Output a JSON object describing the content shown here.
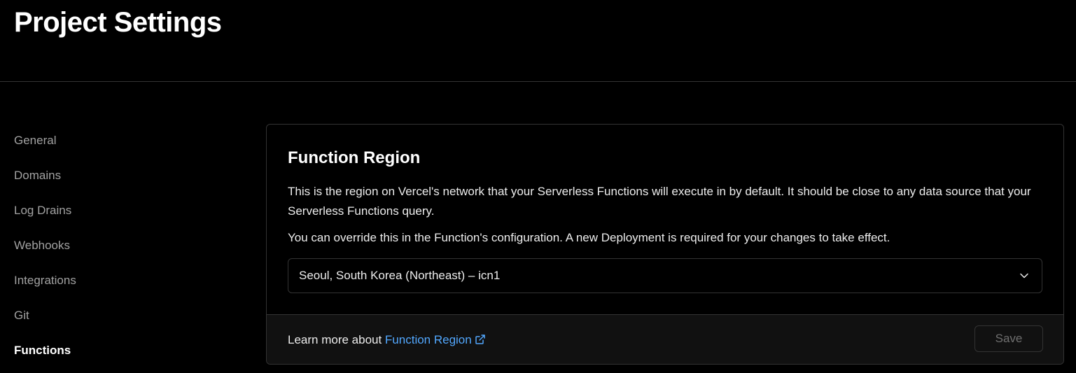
{
  "header": {
    "title": "Project Settings"
  },
  "sidebar": {
    "items": [
      {
        "label": "General",
        "active": false
      },
      {
        "label": "Domains",
        "active": false
      },
      {
        "label": "Log Drains",
        "active": false
      },
      {
        "label": "Webhooks",
        "active": false
      },
      {
        "label": "Integrations",
        "active": false
      },
      {
        "label": "Git",
        "active": false
      },
      {
        "label": "Functions",
        "active": true
      }
    ]
  },
  "function_region": {
    "title": "Function Region",
    "description": "This is the region on Vercel's network that your Serverless Functions will execute in by default. It should be close to any data source that your Serverless Functions query.",
    "override_note": "You can override this in the Function's configuration. A new Deployment is required for your changes to take effect.",
    "select": {
      "value": "Seoul, South Korea (Northeast) – icn1",
      "icon": "chevron-down-icon"
    },
    "footer": {
      "learn_more_prefix": "Learn more about ",
      "learn_more_link": "Function Region",
      "link_icon": "external-link-icon",
      "save_label": "Save",
      "save_disabled": true
    }
  },
  "colors": {
    "background": "#000000",
    "border": "#333333",
    "footer_background": "#111111",
    "link": "#52a8ff",
    "muted_text": "#a1a1a1",
    "text": "#ededed"
  }
}
